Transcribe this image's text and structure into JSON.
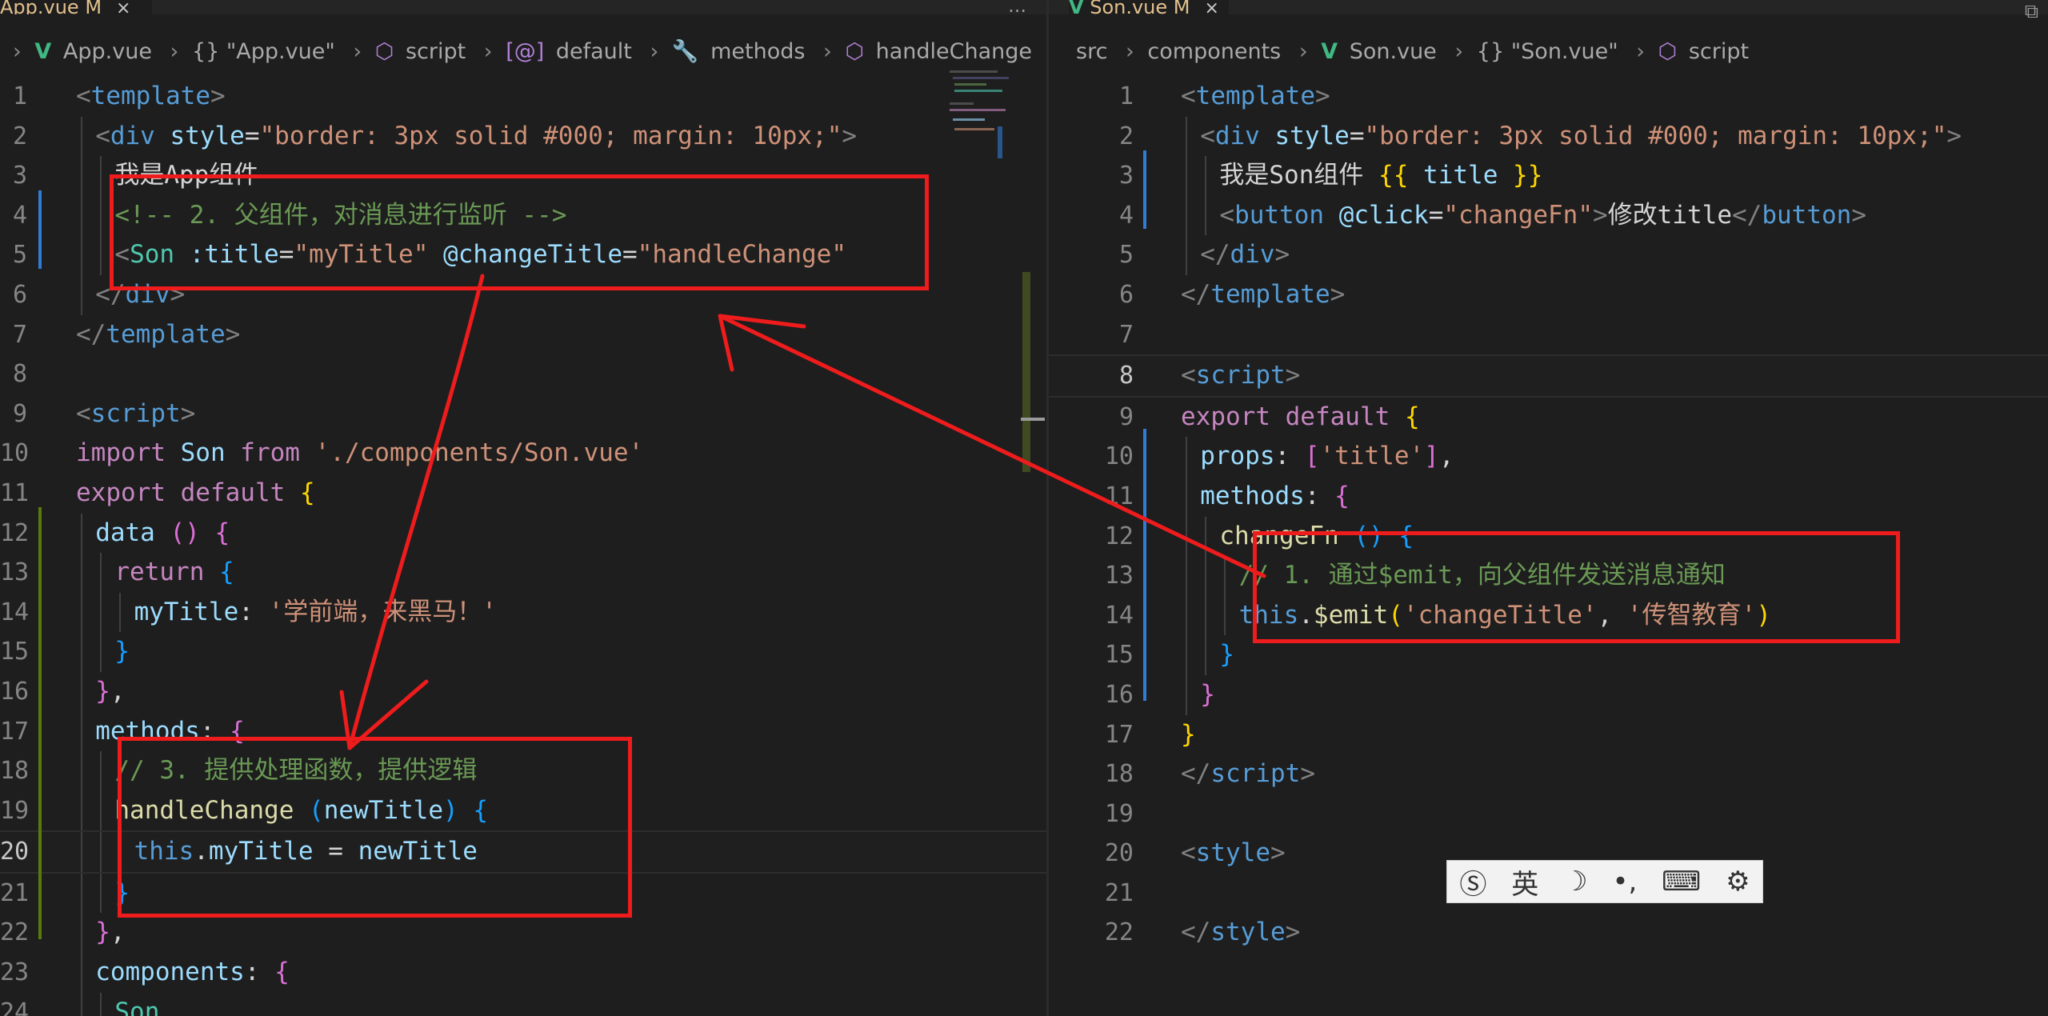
{
  "left_editor": {
    "tab": {
      "title": "App.vue M",
      "close": "×"
    },
    "breadcrumb": [
      "App.vue",
      "{} \"App.vue\"",
      "script",
      "default",
      "methods",
      "handleChange"
    ],
    "lines": [
      {
        "n": "1",
        "tokens": [
          [
            "c-punc",
            "<"
          ],
          [
            "c-tag",
            "template"
          ],
          [
            "c-punc",
            ">"
          ]
        ]
      },
      {
        "n": "2",
        "indent": 1,
        "tokens": [
          [
            "c-punc",
            "<"
          ],
          [
            "c-tag",
            "div"
          ],
          [
            "c-attr",
            " style"
          ],
          [
            "c-text",
            "="
          ],
          [
            "c-str",
            "\"border: 3px solid #000; margin: 10px;\""
          ],
          [
            "c-punc",
            ">"
          ]
        ]
      },
      {
        "n": "3",
        "indent": 2,
        "tokens": [
          [
            "c-text",
            "我是App组件"
          ]
        ]
      },
      {
        "n": "4",
        "indent": 2,
        "tokens": [
          [
            "c-comment",
            "<!-- 2. 父组件，对消息进行监听 -->"
          ]
        ]
      },
      {
        "n": "5",
        "indent": 2,
        "tokens": [
          [
            "c-punc",
            "<"
          ],
          [
            "c-comp",
            "Son"
          ],
          [
            "c-attr",
            " :title"
          ],
          [
            "c-text",
            "="
          ],
          [
            "c-str",
            "\"myTitle\""
          ],
          [
            "c-attr",
            " @changeTitle"
          ],
          [
            "c-text",
            "="
          ],
          [
            "c-str",
            "\"handleChange\""
          ]
        ]
      },
      {
        "n": "6",
        "indent": 1,
        "tokens": [
          [
            "c-punc",
            "</"
          ],
          [
            "c-tag",
            "div"
          ],
          [
            "c-punc",
            ">"
          ]
        ]
      },
      {
        "n": "7",
        "tokens": [
          [
            "c-punc",
            "</"
          ],
          [
            "c-tag",
            "template"
          ],
          [
            "c-punc",
            ">"
          ]
        ]
      },
      {
        "n": "8",
        "tokens": []
      },
      {
        "n": "9",
        "tokens": [
          [
            "c-punc",
            "<"
          ],
          [
            "c-tag",
            "script"
          ],
          [
            "c-punc",
            ">"
          ]
        ]
      },
      {
        "n": "10",
        "tokens": [
          [
            "c-kw",
            "import"
          ],
          [
            "c-var",
            " Son"
          ],
          [
            "c-kw",
            " from"
          ],
          [
            "c-str",
            " './components/Son.vue'"
          ]
        ]
      },
      {
        "n": "11",
        "tokens": [
          [
            "c-kw",
            "export"
          ],
          [
            "c-kw",
            " default"
          ],
          [
            "c-brace1",
            " {"
          ]
        ]
      },
      {
        "n": "12",
        "indent": 1,
        "tokens": [
          [
            "c-var",
            "data"
          ],
          [
            "c-brace2",
            " ()"
          ],
          [
            "c-brace2",
            " {"
          ]
        ]
      },
      {
        "n": "13",
        "indent": 2,
        "tokens": [
          [
            "c-kw",
            "return"
          ],
          [
            "c-brace3",
            " {"
          ]
        ]
      },
      {
        "n": "14",
        "indent": 3,
        "tokens": [
          [
            "c-var",
            "myTitle"
          ],
          [
            "c-text",
            ": "
          ],
          [
            "c-str",
            "'学前端，来黑马！'"
          ]
        ]
      },
      {
        "n": "15",
        "indent": 2,
        "tokens": [
          [
            "c-brace3",
            "}"
          ]
        ]
      },
      {
        "n": "16",
        "indent": 1,
        "tokens": [
          [
            "c-brace2",
            "}"
          ],
          [
            "c-text",
            ","
          ]
        ]
      },
      {
        "n": "17",
        "indent": 1,
        "tokens": [
          [
            "c-var",
            "methods"
          ],
          [
            "c-text",
            ": "
          ],
          [
            "c-brace2",
            "{"
          ]
        ]
      },
      {
        "n": "18",
        "indent": 2,
        "tokens": [
          [
            "c-comment",
            "// 3. 提供处理函数，提供逻辑"
          ]
        ]
      },
      {
        "n": "19",
        "indent": 2,
        "tokens": [
          [
            "c-fn",
            "handleChange"
          ],
          [
            "c-brace3",
            " ("
          ],
          [
            "c-var",
            "newTitle"
          ],
          [
            "c-brace3",
            ")"
          ],
          [
            "c-brace3",
            " {"
          ]
        ]
      },
      {
        "n": "20",
        "indent": 3,
        "active": true,
        "tokens": [
          [
            "c-kw2",
            "this"
          ],
          [
            "c-text",
            "."
          ],
          [
            "c-var",
            "myTitle"
          ],
          [
            "c-text",
            " = "
          ],
          [
            "c-var",
            "newTitle"
          ]
        ]
      },
      {
        "n": "21",
        "indent": 2,
        "tokens": [
          [
            "c-brace3",
            "}"
          ]
        ]
      },
      {
        "n": "22",
        "indent": 1,
        "tokens": [
          [
            "c-brace2",
            "}"
          ],
          [
            "c-text",
            ","
          ]
        ]
      },
      {
        "n": "23",
        "indent": 1,
        "tokens": [
          [
            "c-var",
            "components"
          ],
          [
            "c-text",
            ": "
          ],
          [
            "c-brace2",
            "{"
          ]
        ]
      },
      {
        "n": "24",
        "indent": 2,
        "tokens": [
          [
            "c-comp",
            "Son"
          ]
        ]
      }
    ]
  },
  "right_editor": {
    "tab": {
      "title": "Son.vue M",
      "close": "×"
    },
    "breadcrumb": [
      "src",
      "components",
      "Son.vue",
      "{} \"Son.vue\"",
      "script"
    ],
    "lines": [
      {
        "n": "1",
        "tokens": [
          [
            "c-punc",
            "<"
          ],
          [
            "c-tag",
            "template"
          ],
          [
            "c-punc",
            ">"
          ]
        ]
      },
      {
        "n": "2",
        "indent": 1,
        "tokens": [
          [
            "c-punc",
            "<"
          ],
          [
            "c-tag",
            "div"
          ],
          [
            "c-attr",
            " style"
          ],
          [
            "c-text",
            "="
          ],
          [
            "c-str",
            "\"border: 3px solid #000; margin: 10px;\""
          ],
          [
            "c-punc",
            ">"
          ]
        ]
      },
      {
        "n": "3",
        "indent": 2,
        "tokens": [
          [
            "c-text",
            "我是Son组件 "
          ],
          [
            "c-brace1",
            "{{"
          ],
          [
            "c-var",
            " title "
          ],
          [
            "c-brace1",
            "}}"
          ]
        ]
      },
      {
        "n": "4",
        "indent": 2,
        "tokens": [
          [
            "c-punc",
            "<"
          ],
          [
            "c-tag",
            "button"
          ],
          [
            "c-attr",
            " @click"
          ],
          [
            "c-text",
            "="
          ],
          [
            "c-str",
            "\"changeFn\""
          ],
          [
            "c-punc",
            ">"
          ],
          [
            "c-text",
            "修改title"
          ],
          [
            "c-punc",
            "</"
          ],
          [
            "c-tag",
            "button"
          ],
          [
            "c-punc",
            ">"
          ]
        ]
      },
      {
        "n": "5",
        "indent": 1,
        "tokens": [
          [
            "c-punc",
            "</"
          ],
          [
            "c-tag",
            "div"
          ],
          [
            "c-punc",
            ">"
          ]
        ]
      },
      {
        "n": "6",
        "tokens": [
          [
            "c-punc",
            "</"
          ],
          [
            "c-tag",
            "template"
          ],
          [
            "c-punc",
            ">"
          ]
        ]
      },
      {
        "n": "7",
        "tokens": []
      },
      {
        "n": "8",
        "active": true,
        "tokens": [
          [
            "c-punc",
            "<"
          ],
          [
            "c-tag",
            "script"
          ],
          [
            "c-punc",
            ">"
          ]
        ]
      },
      {
        "n": "9",
        "tokens": [
          [
            "c-kw",
            "export"
          ],
          [
            "c-kw",
            " default"
          ],
          [
            "c-brace1",
            " {"
          ]
        ]
      },
      {
        "n": "10",
        "indent": 1,
        "tokens": [
          [
            "c-var",
            "props"
          ],
          [
            "c-text",
            ": "
          ],
          [
            "c-brace2",
            "["
          ],
          [
            "c-str",
            "'title'"
          ],
          [
            "c-brace2",
            "]"
          ],
          [
            "c-text",
            ","
          ]
        ]
      },
      {
        "n": "11",
        "indent": 1,
        "tokens": [
          [
            "c-var",
            "methods"
          ],
          [
            "c-text",
            ": "
          ],
          [
            "c-brace2",
            "{"
          ]
        ]
      },
      {
        "n": "12",
        "indent": 2,
        "tokens": [
          [
            "c-fn",
            "changeFn"
          ],
          [
            "c-brace3",
            " ()"
          ],
          [
            "c-brace3",
            " {"
          ]
        ]
      },
      {
        "n": "13",
        "indent": 3,
        "tokens": [
          [
            "c-comment",
            "// 1. 通过$emit，向父组件发送消息通知"
          ]
        ]
      },
      {
        "n": "14",
        "indent": 3,
        "tokens": [
          [
            "c-kw2",
            "this"
          ],
          [
            "c-text",
            "."
          ],
          [
            "c-fn",
            "$emit"
          ],
          [
            "c-brace1",
            "("
          ],
          [
            "c-str",
            "'changeTitle'"
          ],
          [
            "c-text",
            ", "
          ],
          [
            "c-str",
            "'传智教育'"
          ],
          [
            "c-brace1",
            ")"
          ]
        ]
      },
      {
        "n": "15",
        "indent": 2,
        "tokens": [
          [
            "c-brace3",
            "}"
          ]
        ]
      },
      {
        "n": "16",
        "indent": 1,
        "tokens": [
          [
            "c-brace2",
            "}"
          ]
        ]
      },
      {
        "n": "17",
        "tokens": [
          [
            "c-brace1",
            "}"
          ]
        ]
      },
      {
        "n": "18",
        "tokens": [
          [
            "c-punc",
            "</"
          ],
          [
            "c-tag",
            "script"
          ],
          [
            "c-punc",
            ">"
          ]
        ]
      },
      {
        "n": "19",
        "tokens": []
      },
      {
        "n": "20",
        "tokens": [
          [
            "c-punc",
            "<"
          ],
          [
            "c-tag",
            "style"
          ],
          [
            "c-punc",
            ">"
          ]
        ]
      },
      {
        "n": "21",
        "tokens": []
      },
      {
        "n": "22",
        "tokens": [
          [
            "c-punc",
            "</"
          ],
          [
            "c-tag",
            "style"
          ],
          [
            "c-punc",
            ">"
          ]
        ]
      }
    ]
  },
  "ime_toolbar": {
    "items": [
      "Ⓢ",
      "英",
      "☽",
      "•,",
      "⌨",
      "⚙"
    ]
  },
  "colors": {
    "annotation_red": "#ee1c1c",
    "editor_bg": "#1e1e1e",
    "modified_tab": "#e2c08d"
  }
}
